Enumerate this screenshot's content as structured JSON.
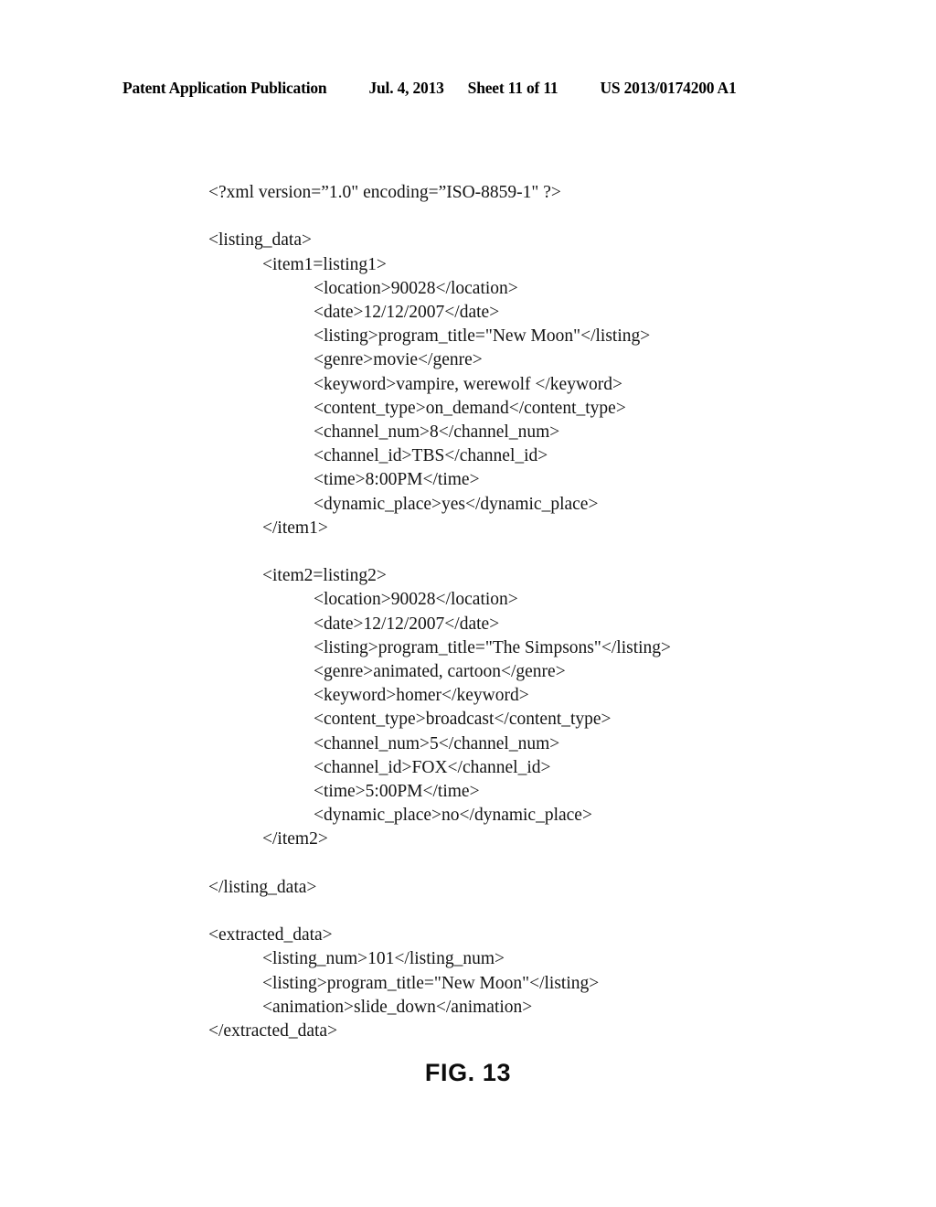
{
  "header": {
    "publication": "Patent Application Publication",
    "date": "Jul. 4, 2013",
    "sheet": "Sheet 11 of 11",
    "patent_number": "US 2013/0174200 A1"
  },
  "figure": {
    "caption": "FIG. 13"
  },
  "code": {
    "lines": [
      {
        "indent": 0,
        "text": "<?xml version=”1.0\" encoding=”ISO-8859-1\" ?>"
      },
      {
        "indent": 0,
        "text": ""
      },
      {
        "indent": 0,
        "text": "<listing_data>"
      },
      {
        "indent": 1,
        "text": "<item1=listing1>"
      },
      {
        "indent": 2,
        "text": "<location>90028</location>"
      },
      {
        "indent": 2,
        "text": "<date>12/12/2007</date>"
      },
      {
        "indent": 2,
        "text": "<listing>program_title=\"New Moon\"</listing>"
      },
      {
        "indent": 2,
        "text": "<genre>movie</genre>"
      },
      {
        "indent": 2,
        "text": "<keyword>vampire, werewolf </keyword>"
      },
      {
        "indent": 2,
        "text": "<content_type>on_demand</content_type>"
      },
      {
        "indent": 2,
        "text": "<channel_num>8</channel_num>"
      },
      {
        "indent": 2,
        "text": "<channel_id>TBS</channel_id>"
      },
      {
        "indent": 2,
        "text": "<time>8:00PM</time>"
      },
      {
        "indent": 2,
        "text": "<dynamic_place>yes</dynamic_place>"
      },
      {
        "indent": 1,
        "text": "</item1>"
      },
      {
        "indent": 0,
        "text": ""
      },
      {
        "indent": 1,
        "text": "<item2=listing2>"
      },
      {
        "indent": 2,
        "text": "<location>90028</location>"
      },
      {
        "indent": 2,
        "text": "<date>12/12/2007</date>"
      },
      {
        "indent": 2,
        "text": "<listing>program_title=\"The Simpsons\"</listing>"
      },
      {
        "indent": 2,
        "text": "<genre>animated, cartoon</genre>"
      },
      {
        "indent": 2,
        "text": "<keyword>homer</keyword>"
      },
      {
        "indent": 2,
        "text": "<content_type>broadcast</content_type>"
      },
      {
        "indent": 2,
        "text": "<channel_num>5</channel_num>"
      },
      {
        "indent": 2,
        "text": "<channel_id>FOX</channel_id>"
      },
      {
        "indent": 2,
        "text": "<time>5:00PM</time>"
      },
      {
        "indent": 2,
        "text": "<dynamic_place>no</dynamic_place>"
      },
      {
        "indent": 1,
        "text": "</item2>"
      },
      {
        "indent": 0,
        "text": ""
      },
      {
        "indent": 0,
        "text": "</listing_data>"
      },
      {
        "indent": 0,
        "text": ""
      },
      {
        "indent": 0,
        "text": "<extracted_data>"
      },
      {
        "indent": 1,
        "text": "<listing_num>101</listing_num>"
      },
      {
        "indent": 1,
        "text": "<listing>program_title=\"New Moon\"</listing>"
      },
      {
        "indent": 1,
        "text": "<animation>slide_down</animation>"
      },
      {
        "indent": 0,
        "text": "</extracted_data>"
      }
    ]
  }
}
